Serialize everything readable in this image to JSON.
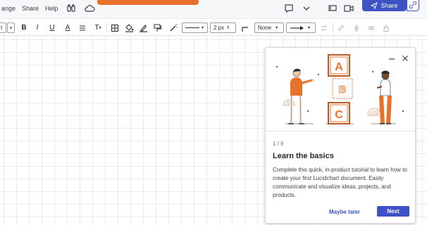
{
  "menu": {
    "items": [
      "ange",
      "Share",
      "Help"
    ]
  },
  "top_right": {
    "share_label": "Share"
  },
  "toolbar": {
    "left_partial": "t",
    "plus": "+",
    "bold": "B",
    "italic": "I",
    "underline": "U",
    "text_color": "A",
    "text_options": "T",
    "line_width": "2 px",
    "arrow_start": "None"
  },
  "tutorial": {
    "step": "1 / 6",
    "title": "Learn the basics",
    "description": "Complete this quick, in-product tutorial to learn how to create your first Lucidchart document. Easily communicate and visualize ideas, projects, and products.",
    "maybe_later": "Maybe later",
    "next": "Next",
    "blocks": [
      "A",
      "B",
      "C"
    ]
  },
  "colors": {
    "accent": "#3d52c4",
    "brand_orange": "#e8722c"
  }
}
